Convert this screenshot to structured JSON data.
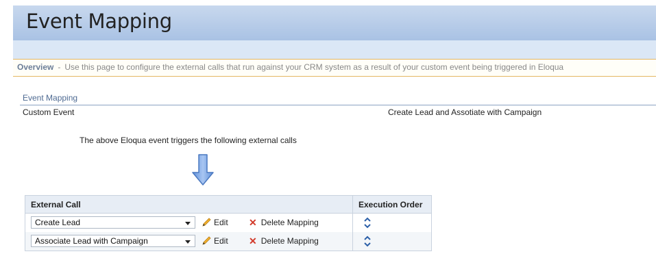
{
  "page": {
    "title": "Event Mapping",
    "overview_label": "Overview",
    "overview_sep": "-",
    "overview_text": "Use this page to configure the external calls that run against your CRM system as a result of your custom event being triggered in Eloqua"
  },
  "section": {
    "header": "Event Mapping",
    "custom_event_label": "Custom Event",
    "custom_event_value": "Create Lead and Assotiate with Campaign",
    "triggers_text": "The above Eloqua event triggers the following external calls"
  },
  "table": {
    "col_call": "External Call",
    "col_order": "Execution Order",
    "rows": [
      {
        "call": "Create Lead",
        "edit": "Edit",
        "delete": "Delete Mapping"
      },
      {
        "call": "Associate Lead with Campaign",
        "edit": "Edit",
        "delete": "Delete Mapping"
      }
    ]
  },
  "colors": {
    "title_bar": "#b4c9e7",
    "section_header": "#4e6a92",
    "overview_border": "#e4b660",
    "arrow_fill": "#7aa5e6",
    "delete_x": "#d23a2a"
  },
  "icons": [
    "pencil-icon",
    "delete-x-icon",
    "sort-order-icon",
    "down-arrow-icon",
    "dropdown-chevron-icon"
  ]
}
